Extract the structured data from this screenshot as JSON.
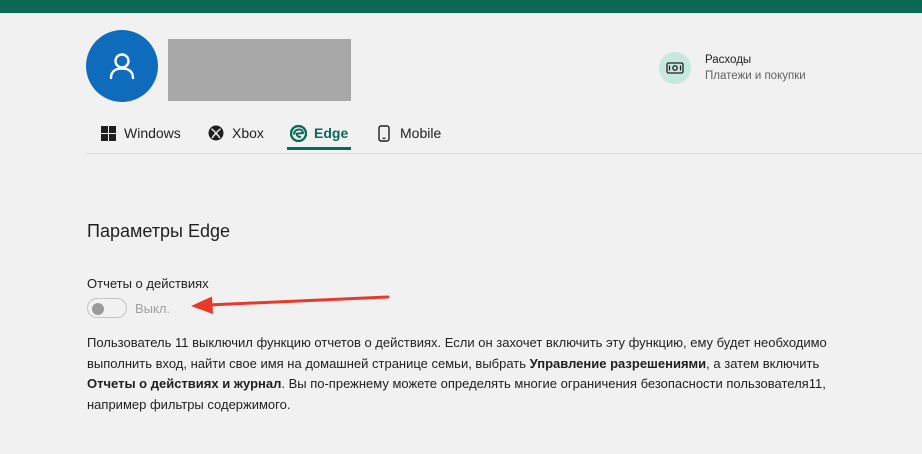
{
  "colors": {
    "accent": "#0b6a55",
    "avatar_bg": "#0f6cbd",
    "arrow": "#e8392a",
    "redacted": "#a8a8a8"
  },
  "header": {
    "avatar_icon": "person-icon",
    "expenses": {
      "icon": "money-icon",
      "title": "Расходы",
      "subtitle": "Платежи и покупки"
    }
  },
  "tabs": [
    {
      "label": "Windows",
      "icon": "windows-icon",
      "active": false
    },
    {
      "label": "Xbox",
      "icon": "xbox-icon",
      "active": false
    },
    {
      "label": "Edge",
      "icon": "edge-icon",
      "active": true
    },
    {
      "label": "Mobile",
      "icon": "mobile-icon",
      "active": false
    }
  ],
  "main": {
    "section_title": "Параметры Edge",
    "activity_label": "Отчеты о действиях",
    "toggle_on": false,
    "toggle_state": "Выкл.",
    "description": {
      "part1": "Пользователь 11 выключил функцию отчетов о действиях. Если он захочет включить эту функцию, ему будет необходимо выполнить вход, найти свое имя на домашней странице семьи, выбрать ",
      "bold1": "Управление разрешениями",
      "part2": ", а затем включить ",
      "bold2": "Отчеты о действиях и журнал",
      "part3": ". Вы по-прежнему можете определять многие ограничения безопасности пользователя11, например фильтры содержимого."
    }
  }
}
